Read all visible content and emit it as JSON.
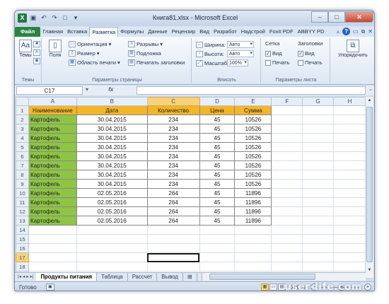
{
  "window": {
    "title": "Книга81.xlsx - Microsoft Excel",
    "logo": "X",
    "quick_access": [
      "save-icon",
      "undo-icon",
      "redo-icon",
      "new-icon",
      "dropdown-icon"
    ]
  },
  "tabs": [
    "Файл",
    "Главная",
    "Вставка",
    "Разметка",
    "Формулы",
    "Данные",
    "Рецензир",
    "Вид",
    "Разработ",
    "Надстрой",
    "Foxit PDF",
    "ABBYY PD"
  ],
  "active_tab": "Разметка",
  "ribbon": {
    "themes": {
      "label": "Темы",
      "btn": "Темы",
      "icon": "Aa"
    },
    "page_setup": {
      "label": "Параметры страницы",
      "fields_btn": "Поля",
      "orientation": "Ориентация",
      "size": "Размер",
      "print_area": "Область печати",
      "breaks": "Разрывы",
      "background": "Подложка",
      "print_titles": "Печатать заголовки"
    },
    "fit": {
      "label": "Вписать",
      "width_label": "Ширина:",
      "width_value": "Авто",
      "height_label": "Высота:",
      "height_value": "Авто",
      "scale_label": "Масштаб:",
      "scale_value": "100%"
    },
    "sheet_options": {
      "label": "Параметры листа",
      "gridlines": "Сетка",
      "headings": "Заголовки",
      "view": "Вид",
      "print": "Печать",
      "gridlines_view": true,
      "gridlines_print": false,
      "headings_view": true,
      "headings_print": false
    },
    "arrange": {
      "label": "Упорядочить"
    }
  },
  "formula_bar": {
    "name_box": "C17",
    "fx": "fx",
    "value": ""
  },
  "grid": {
    "columns": [
      "A",
      "B",
      "C",
      "D",
      "E",
      "F",
      "G",
      "H"
    ],
    "selected_column": "C",
    "selected_row": 17,
    "active_cell": "C17",
    "header_row": [
      "Наименование",
      "Дата",
      "Количество",
      "Цена",
      "Сумма"
    ],
    "rows": [
      [
        "Картофель",
        "30.04.2015",
        "234",
        "45",
        "10526"
      ],
      [
        "Картофель",
        "30.04.2015",
        "234",
        "45",
        "10526"
      ],
      [
        "Картофель",
        "30.04.2015",
        "234",
        "45",
        "10526"
      ],
      [
        "Картофель",
        "30.04.2015",
        "234",
        "45",
        "10526"
      ],
      [
        "Картофель",
        "30.04.2015",
        "234",
        "45",
        "10526"
      ],
      [
        "Картофель",
        "30.04.2015",
        "234",
        "45",
        "10526"
      ],
      [
        "Картофель",
        "30.04.2015",
        "234",
        "45",
        "10526"
      ],
      [
        "Картофель",
        "30.04.2015",
        "234",
        "45",
        "10526"
      ],
      [
        "Картофель",
        "02.05.2016",
        "264",
        "45",
        "11896"
      ],
      [
        "Картофель",
        "02.05.2016",
        "264",
        "45",
        "11896"
      ],
      [
        "Картофель",
        "02.05.2016",
        "264",
        "45",
        "11896"
      ],
      [
        "Картофель",
        "02.05.2016",
        "264",
        "45",
        "11896"
      ]
    ],
    "total_rows": 19
  },
  "sheets": [
    "Продукты питания",
    "Таблица",
    "Рассчет",
    "Вывод"
  ],
  "active_sheet": "Продукты питания",
  "status": {
    "ready": "Готово",
    "zoom": "100%",
    "zoom_fraction": 0.5
  },
  "watermark": "user-life.com",
  "colors": {
    "header_fill": "#f3b629",
    "name_fill": "#8ec544",
    "file_tab": "#2a8443"
  }
}
